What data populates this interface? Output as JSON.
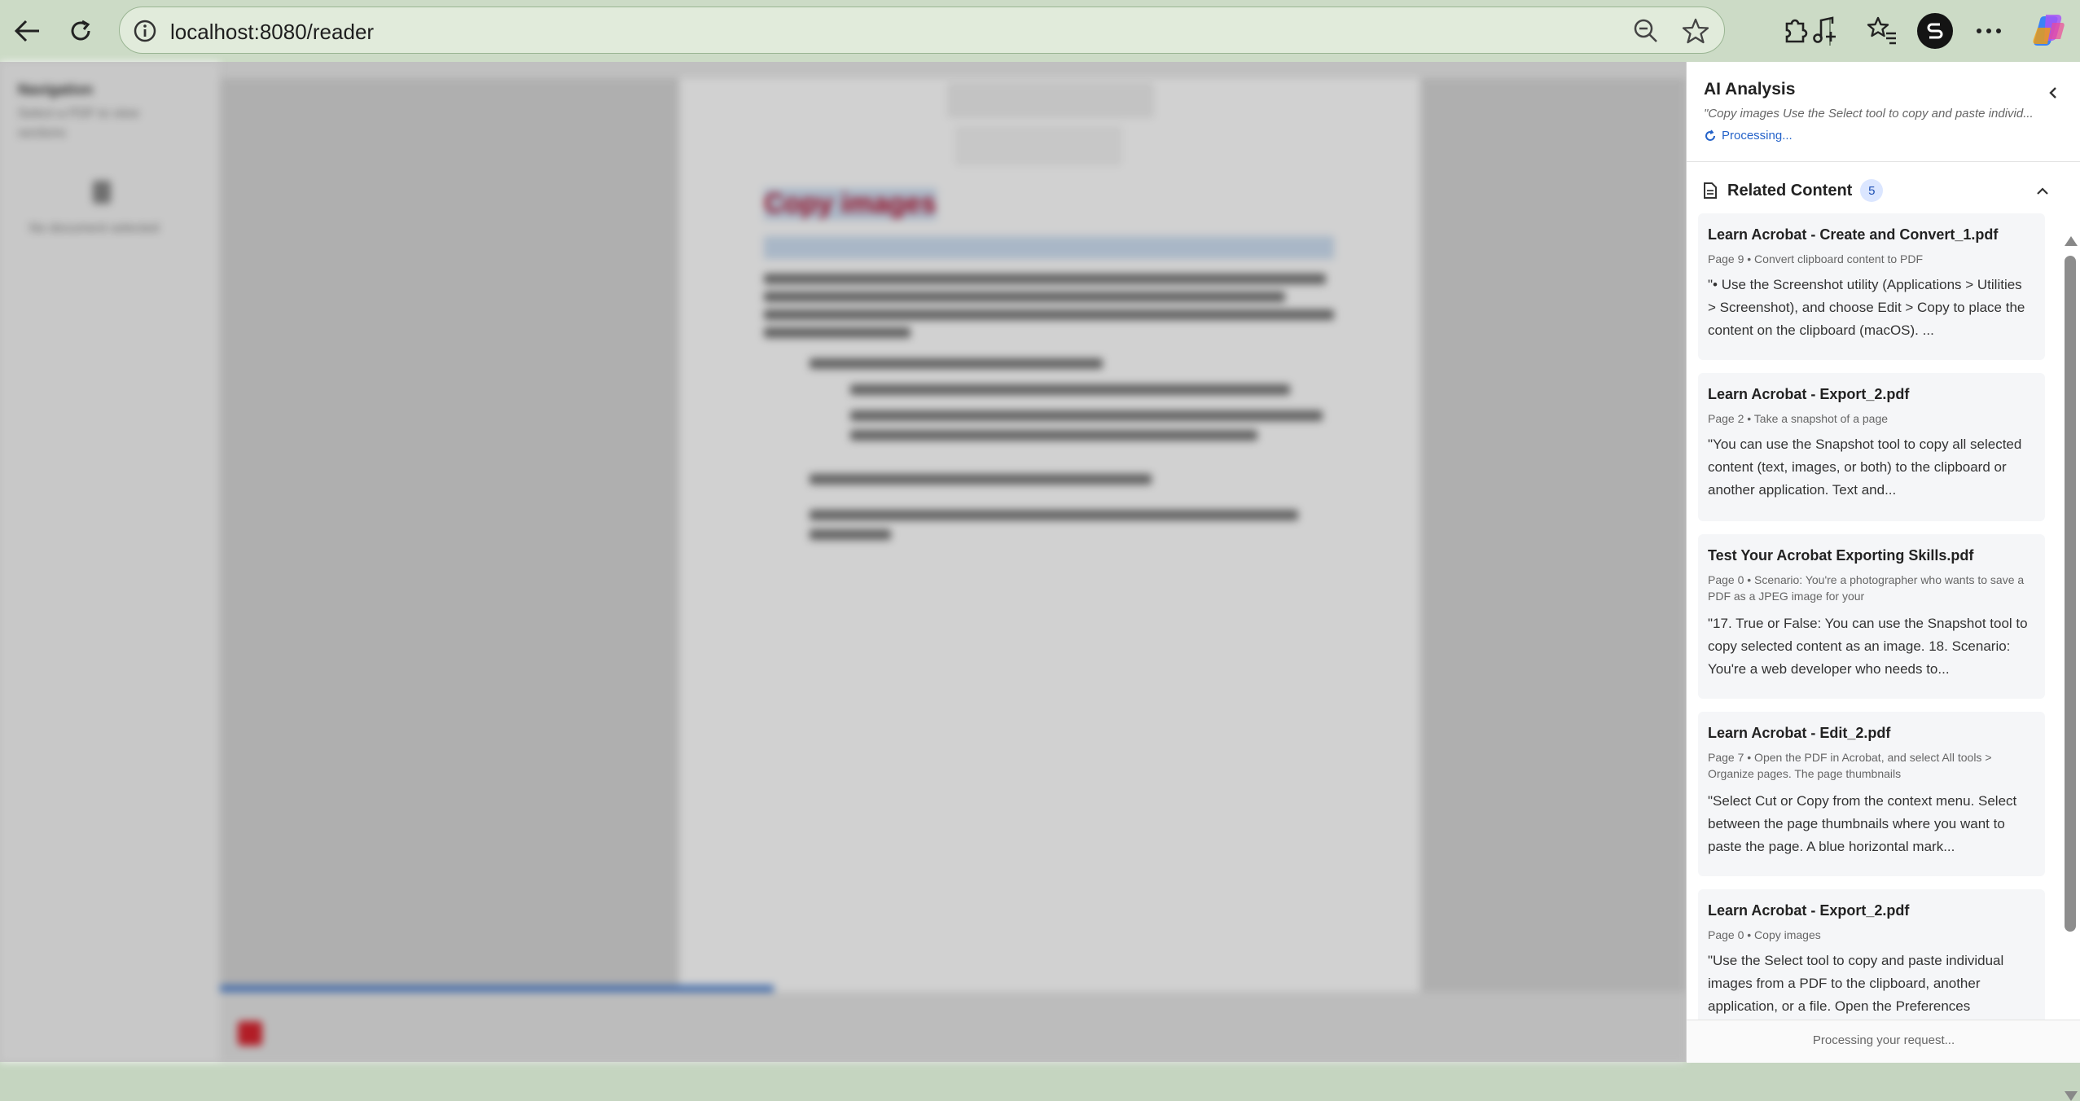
{
  "browser": {
    "url": "localhost:8080/reader",
    "profile_letter": "S"
  },
  "reader": {
    "nav_title": "Navigation",
    "nav_subtitle": "Select a PDF to view sections",
    "nav_empty": "No document selected",
    "doc_title": "Copy images"
  },
  "panel": {
    "title": "AI Analysis",
    "query": "\"Copy images Use the Select tool to copy and paste individ...",
    "status": "Processing...",
    "related_label": "Related Content",
    "related_count": "5",
    "footer_status": "Processing your request...",
    "cards": [
      {
        "title": "Learn Acrobat - Create and Convert_1.pdf",
        "meta": "Page 9 • Convert clipboard content to PDF",
        "body": "\"• Use the Screenshot utility (Applications > Utilities > Screenshot), and choose Edit > Copy to place the content on the clipboard (macOS). ..."
      },
      {
        "title": "Learn Acrobat - Export_2.pdf",
        "meta": "Page 2 • Take a snapshot of a page",
        "body": "\"You can use the Snapshot tool to copy all selected content (text, images, or both) to the clipboard or another application. Text and..."
      },
      {
        "title": "Test Your Acrobat Exporting Skills.pdf",
        "meta": "Page 0 • Scenario: You're a photographer who wants to save a PDF as a JPEG image for your",
        "body": "\"17. True or False: You can use the Snapshot tool to copy selected content as an image. 18. Scenario: You're a web developer who needs to..."
      },
      {
        "title": "Learn Acrobat - Edit_2.pdf",
        "meta": "Page 7 • Open the PDF in Acrobat, and select All tools > Organize pages. The page thumbnails",
        "body": "\"Select Cut or Copy from the context menu. Select between the page thumbnails where you want to paste the page. A blue horizontal mark..."
      },
      {
        "title": "Learn Acrobat - Export_2.pdf",
        "meta": "Page 0 • Copy images",
        "body": "\"Use the Select tool to copy and paste individual images from a PDF to the clipboard, another application, or a file. Open the Preferences"
      }
    ]
  }
}
